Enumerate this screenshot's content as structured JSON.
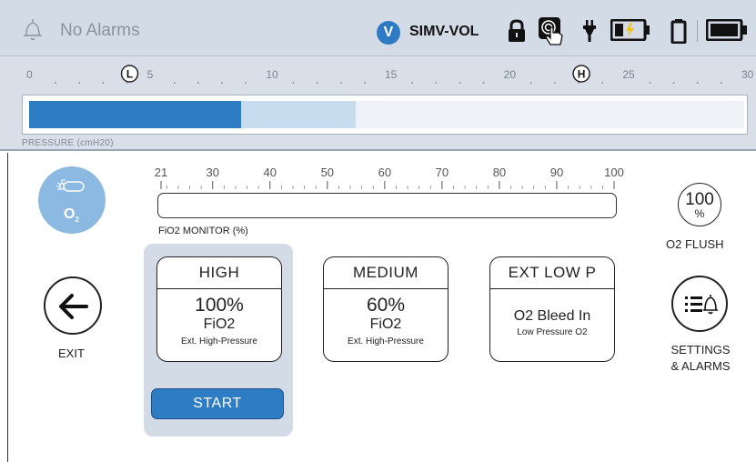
{
  "status_bar": {
    "alarm_text": "No Alarms",
    "mode_badge": "V",
    "mode_text": "SIMV-VOL",
    "icons": [
      "bell-icon",
      "lock-icon",
      "touch-icon",
      "plug-icon",
      "battery-charging-icon",
      "battery-icon",
      "battery-full-icon"
    ]
  },
  "pressure": {
    "ticks": [
      "0",
      "5",
      "10",
      "15",
      "20",
      "25",
      "30"
    ],
    "low_marker": "L",
    "high_marker": "H",
    "label": "PRESSURE (cmH20)",
    "low_limit": 4,
    "high_limit": 23,
    "current_value": 8.9,
    "peak_value": 13.7,
    "scale_min": 0,
    "scale_max": 30
  },
  "oxygen": {
    "button_label": "O",
    "button_sub": "2"
  },
  "fio2": {
    "ticks": [
      "21",
      "30",
      "40",
      "50",
      "60",
      "70",
      "80",
      "90",
      "100"
    ],
    "label": "FiO2 MONITOR (%)"
  },
  "flush": {
    "value": "100",
    "unit": "%",
    "label": "O2 FLUSH"
  },
  "exit": {
    "label": "EXIT"
  },
  "settings": {
    "line1": "SETTINGS",
    "line2": "& ALARMS"
  },
  "modes": [
    {
      "title": "HIGH",
      "value": "100%",
      "gas": "FiO2",
      "source": "Ext. High-Pressure"
    },
    {
      "title": "MEDIUM",
      "value": "60%",
      "gas": "FiO2",
      "source": "Ext. High-Pressure"
    },
    {
      "title": "EXT LOW P",
      "value": "",
      "gas": "O2 Bleed In",
      "source": "Low Pressure O2"
    }
  ],
  "start_label": "START",
  "colors": {
    "accent": "#2e7cc4",
    "panel": "#d3dbe6",
    "o2_button": "#8cb9e2"
  }
}
